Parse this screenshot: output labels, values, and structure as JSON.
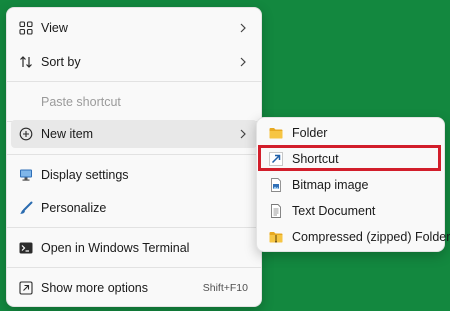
{
  "main_menu": {
    "view_label": "View",
    "sort_by_label": "Sort by",
    "paste_shortcut_label": "Paste shortcut",
    "new_item_label": "New item",
    "display_settings_label": "Display settings",
    "personalize_label": "Personalize",
    "open_terminal_label": "Open in Windows Terminal",
    "show_more_label": "Show more options",
    "show_more_shortcut": "Shift+F10"
  },
  "new_item_submenu": {
    "folder_label": "Folder",
    "shortcut_label": "Shortcut",
    "bitmap_label": "Bitmap image",
    "text_document_label": "Text Document",
    "compressed_folder_label": "Compressed (zipped) Folder"
  },
  "colors": {
    "desktop_background": "#13883f",
    "highlight_border": "#d21e2b",
    "menu_background": "#f9f9f9",
    "hover_background": "#e8e8e8",
    "disabled_text": "#9b9b9b"
  },
  "icons": {
    "view": "grid-icon",
    "sort_by": "sort-arrows-icon",
    "new_item": "plus-circle-icon",
    "display_settings": "monitor-icon",
    "personalize": "brush-icon",
    "open_terminal": "terminal-icon",
    "show_more": "show-more-icon",
    "folder": "folder-icon",
    "shortcut": "shortcut-arrow-icon",
    "bitmap": "bitmap-image-icon",
    "text_document": "text-document-icon",
    "compressed_folder": "zip-folder-icon"
  }
}
